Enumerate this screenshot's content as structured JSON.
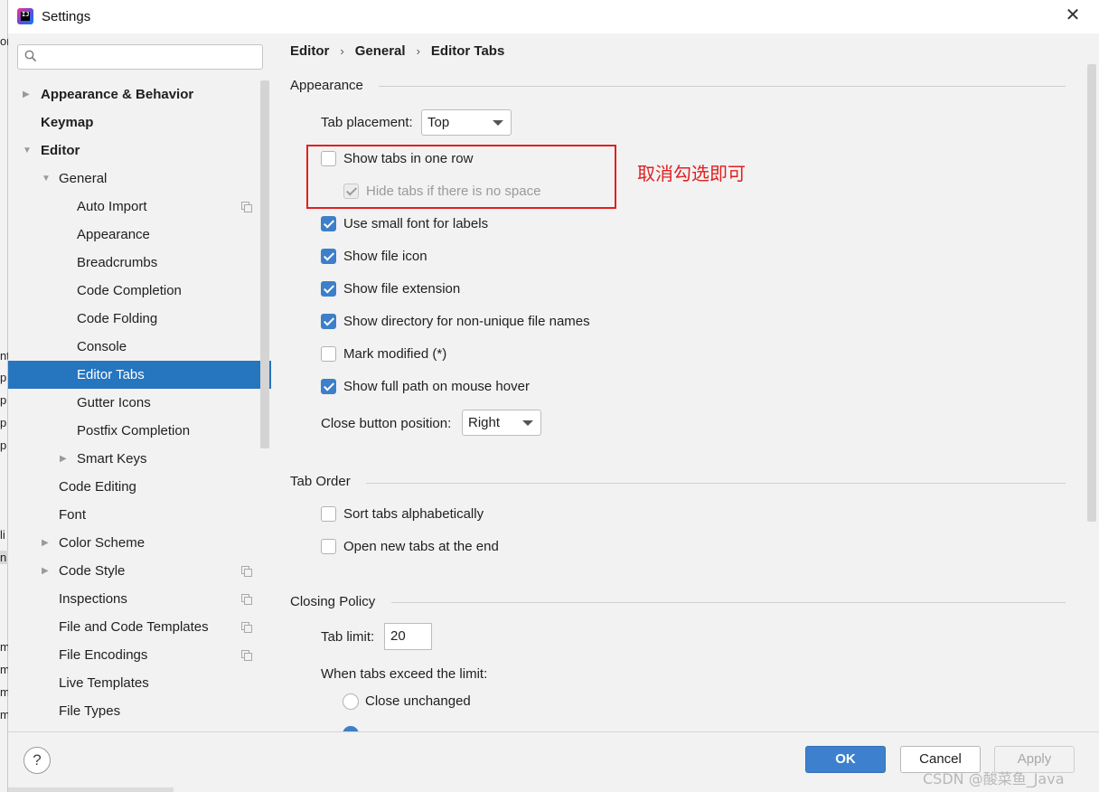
{
  "window": {
    "title": "Settings",
    "close_label": "✕"
  },
  "background_app": {
    "edge_letters": [
      "or",
      "nt",
      "p",
      "p",
      "p",
      "p",
      "li",
      "n",
      "m",
      "m",
      "m",
      "m"
    ]
  },
  "search": {
    "value": "",
    "placeholder": ""
  },
  "sidebar": {
    "items": [
      {
        "label": "Appearance & Behavior",
        "level": 0,
        "arrow": "right",
        "bold": true
      },
      {
        "label": "Keymap",
        "level": 0,
        "arrow": "",
        "bold": true
      },
      {
        "label": "Editor",
        "level": 0,
        "arrow": "down",
        "bold": true
      },
      {
        "label": "General",
        "level": 1,
        "arrow": "down"
      },
      {
        "label": "Auto Import",
        "level": 2,
        "copy_icon": true
      },
      {
        "label": "Appearance",
        "level": 2
      },
      {
        "label": "Breadcrumbs",
        "level": 2
      },
      {
        "label": "Code Completion",
        "level": 2
      },
      {
        "label": "Code Folding",
        "level": 2
      },
      {
        "label": "Console",
        "level": 2
      },
      {
        "label": "Editor Tabs",
        "level": 2,
        "selected": true
      },
      {
        "label": "Gutter Icons",
        "level": 2
      },
      {
        "label": "Postfix Completion",
        "level": 2
      },
      {
        "label": "Smart Keys",
        "level": 2,
        "arrow": "right"
      },
      {
        "label": "Code Editing",
        "level": 1
      },
      {
        "label": "Font",
        "level": 1
      },
      {
        "label": "Color Scheme",
        "level": 1,
        "arrow": "right"
      },
      {
        "label": "Code Style",
        "level": 1,
        "arrow": "right",
        "copy_icon": true
      },
      {
        "label": "Inspections",
        "level": 1,
        "copy_icon": true
      },
      {
        "label": "File and Code Templates",
        "level": 1,
        "copy_icon": true
      },
      {
        "label": "File Encodings",
        "level": 1,
        "copy_icon": true
      },
      {
        "label": "Live Templates",
        "level": 1
      },
      {
        "label": "File Types",
        "level": 1
      }
    ]
  },
  "breadcrumb": [
    "Editor",
    "General",
    "Editor Tabs"
  ],
  "breadcrumb_separator": "›",
  "appearance": {
    "section_title": "Appearance",
    "tab_placement_label": "Tab placement:",
    "tab_placement_value": "Top",
    "show_tabs_one_row": {
      "label": "Show tabs in one row",
      "checked": false
    },
    "hide_tabs_no_space": {
      "label": "Hide tabs if there is no space",
      "checked": true,
      "disabled": true
    },
    "small_font": {
      "label": "Use small font for labels",
      "checked": true
    },
    "file_icon": {
      "label": "Show file icon",
      "checked": true
    },
    "file_extension": {
      "label": "Show file extension",
      "checked": true
    },
    "directory_non_unique": {
      "label": "Show directory for non-unique file names",
      "checked": true
    },
    "mark_modified": {
      "label": "Mark modified (*)",
      "checked": false
    },
    "full_path_hover": {
      "label": "Show full path on mouse hover",
      "checked": true
    },
    "close_button_label": "Close button position:",
    "close_button_value": "Right"
  },
  "annotation": {
    "note": "取消勾选即可",
    "color": "#e02020"
  },
  "tab_order": {
    "section_title": "Tab Order",
    "sort_alpha": {
      "label": "Sort tabs alphabetically",
      "checked": false
    },
    "open_at_end": {
      "label": "Open new tabs at the end",
      "checked": false
    }
  },
  "closing_policy": {
    "section_title": "Closing Policy",
    "tab_limit_label": "Tab limit:",
    "tab_limit_value": "20",
    "exceed_label": "When tabs exceed the limit:",
    "close_unchanged": {
      "label": "Close unchanged",
      "selected": false
    },
    "close_second_option_selected": true
  },
  "footer": {
    "help_label": "?",
    "ok_label": "OK",
    "cancel_label": "Cancel",
    "apply_label": "Apply"
  },
  "watermark": "CSDN @酸菜鱼_Java",
  "colors": {
    "selection": "#2675bf",
    "checkbox_checked": "#3d7fc9",
    "ok_button": "#3d80ce",
    "panel_bg": "#f2f2f2"
  }
}
